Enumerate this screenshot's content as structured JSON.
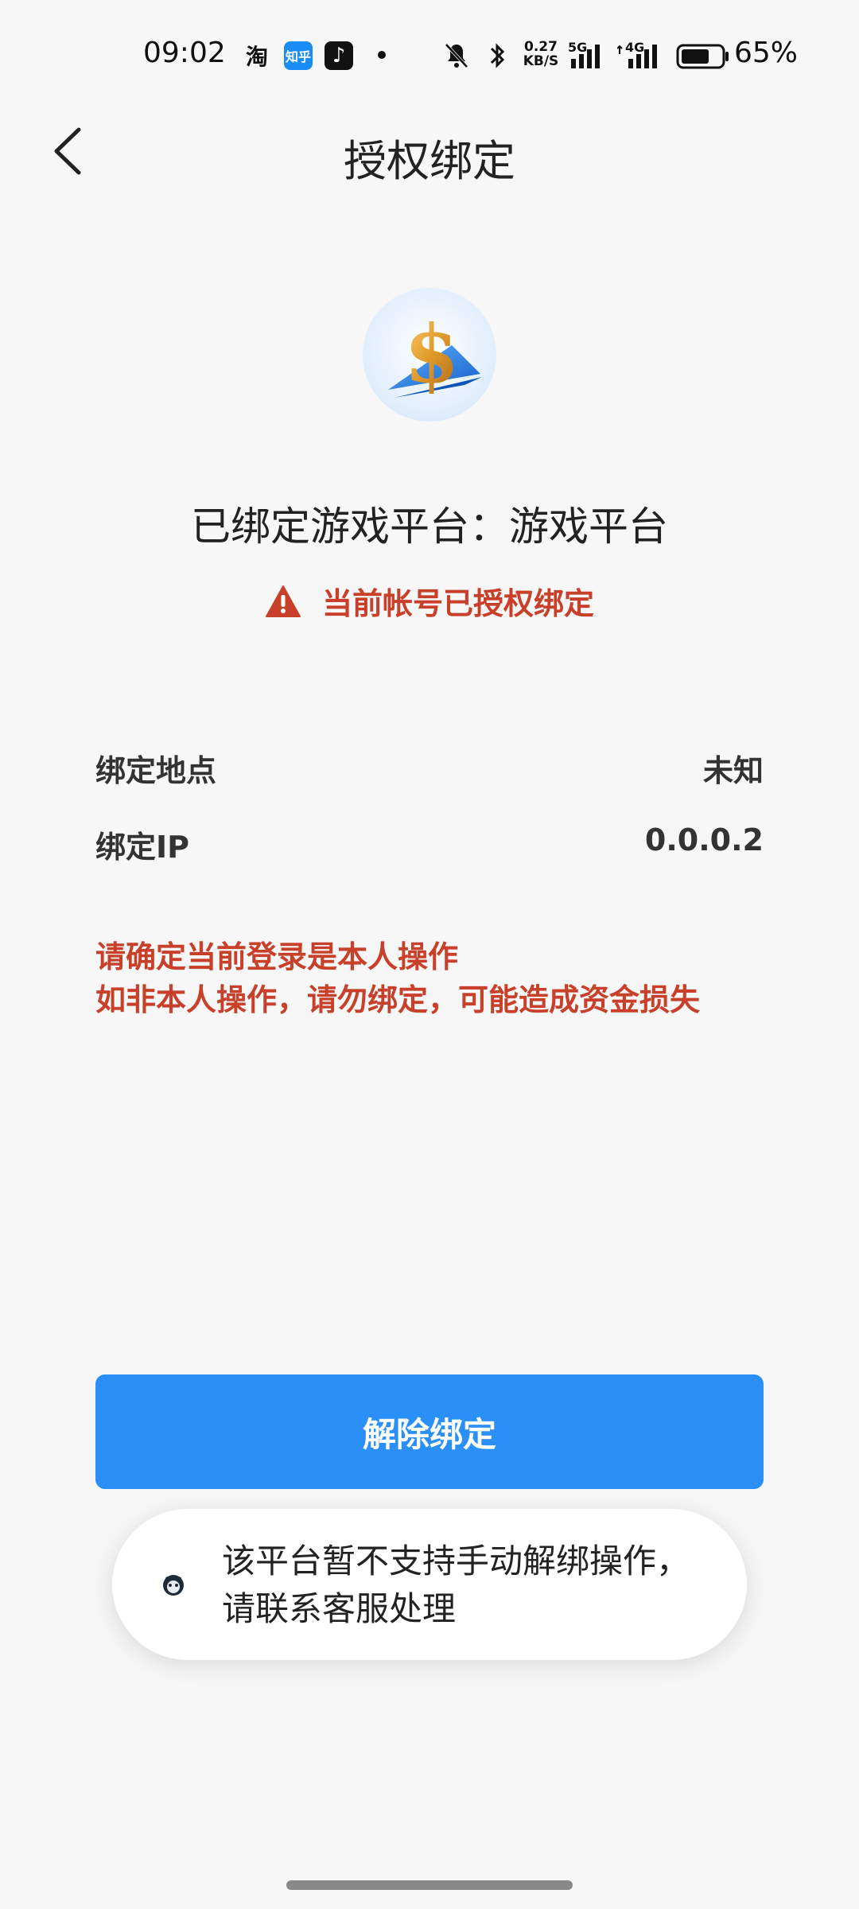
{
  "status_bar": {
    "time": "09:02",
    "apps": [
      {
        "icon": "taobao-icon",
        "label": "淘"
      },
      {
        "icon": "zhihu-icon",
        "label": "知乎"
      },
      {
        "icon": "douyin-icon",
        "label": "♪"
      }
    ],
    "net_speed_value": "0.27",
    "net_speed_unit": "KB/S",
    "signal_1_label": "5G",
    "signal_2_label": "4G",
    "battery_percent": "65%"
  },
  "header": {
    "title": "授权绑定"
  },
  "main": {
    "bound_platform_text": "已绑定游戏平台：游戏平台",
    "warning_text": "当前帐号已授权绑定",
    "rows": [
      {
        "label": "绑定地点",
        "value": "未知"
      },
      {
        "label": "绑定IP",
        "value": "0.0.0.2"
      }
    ],
    "notice_line1": "请确定当前登录是本人操作",
    "notice_line2": "如非本人操作，请勿绑定，可能造成资金损失",
    "unbind_button": "解除绑定"
  },
  "toast": {
    "line1": "该平台暂不支持手动解绑操作，",
    "line2": "请联系客服处理"
  },
  "colors": {
    "accent": "#2a8ff7",
    "warning": "#c8402a",
    "background": "#f7f7f7"
  }
}
